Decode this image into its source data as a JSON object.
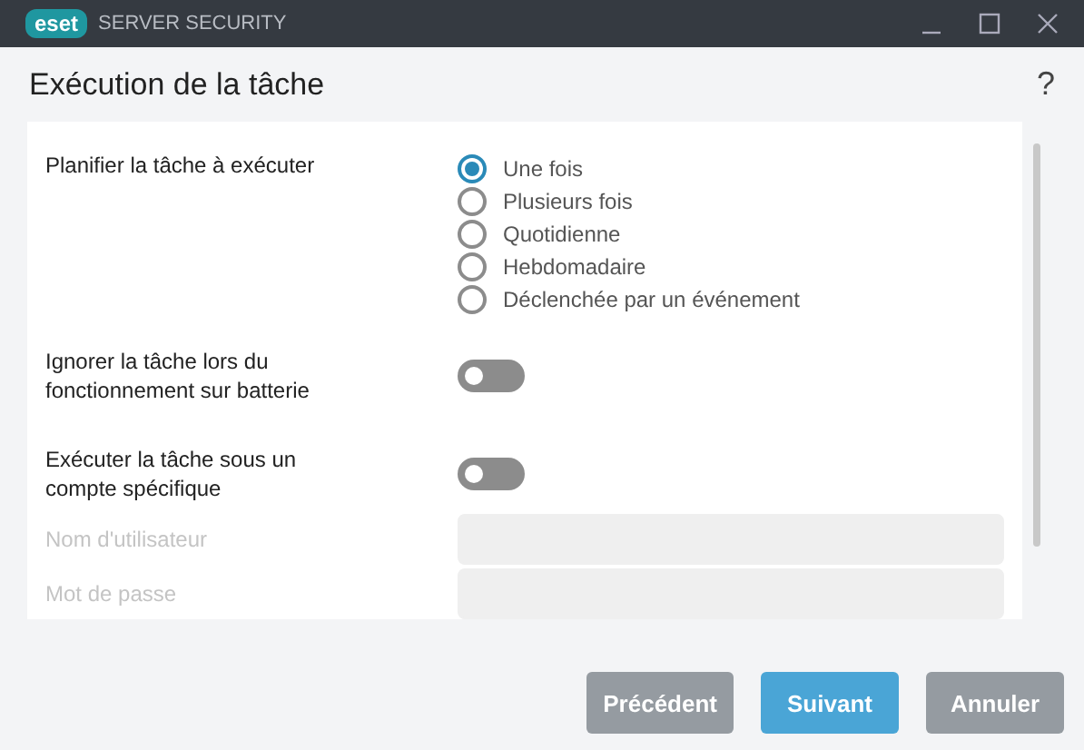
{
  "window": {
    "logo": "eset",
    "title": "SERVER SECURITY"
  },
  "header": {
    "title": "Exécution de la tâche",
    "help": "?"
  },
  "schedule": {
    "label": "Planifier la tâche à exécuter",
    "options": [
      {
        "label": "Une fois",
        "selected": true
      },
      {
        "label": "Plusieurs fois",
        "selected": false
      },
      {
        "label": "Quotidienne",
        "selected": false
      },
      {
        "label": "Hebdomadaire",
        "selected": false
      },
      {
        "label": "Déclenchée par un événement",
        "selected": false
      }
    ]
  },
  "toggles": [
    {
      "label": "Ignorer la tâche lors du fonctionnement sur batterie",
      "on": false
    },
    {
      "label": "Exécuter la tâche sous un compte spécifique",
      "on": false
    }
  ],
  "fields": [
    {
      "label": "Nom d'utilisateur",
      "disabled": true
    },
    {
      "label": "Mot de passe",
      "disabled": true
    }
  ],
  "buttons": [
    {
      "label": "Précédent",
      "kind": "secondary"
    },
    {
      "label": "Suivant",
      "kind": "primary"
    },
    {
      "label": "Annuler",
      "kind": "secondary"
    }
  ]
}
